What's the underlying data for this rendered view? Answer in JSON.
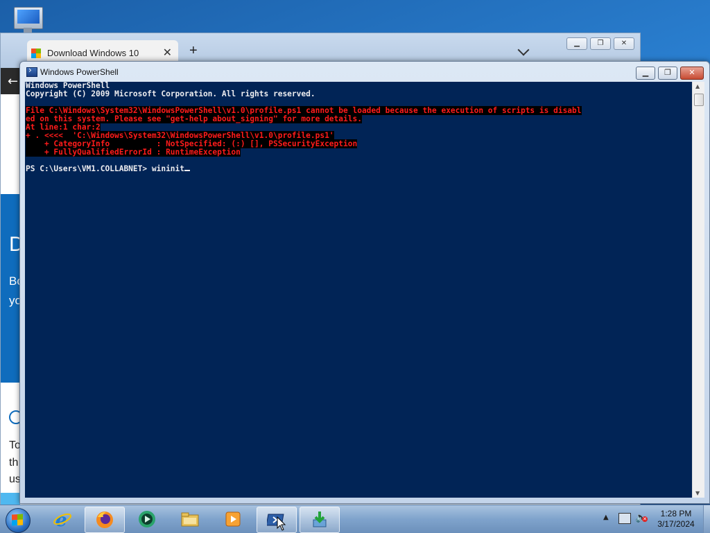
{
  "browser": {
    "tab_title": "Download Windows 10",
    "tab_close": "✕",
    "new_tab": "+",
    "back_arrow": "←",
    "hero_glyph": "D",
    "hero_lines": [
      "Bo",
      "yo"
    ],
    "body_lines": [
      "To",
      "th",
      "us"
    ]
  },
  "powershell": {
    "title": "Windows PowerShell",
    "lines": [
      {
        "text": "Windows PowerShell",
        "type": "normal"
      },
      {
        "text": "Copyright (C) 2009 Microsoft Corporation. All rights reserved.",
        "type": "normal"
      },
      {
        "text": "",
        "type": "normal"
      },
      {
        "text": "File C:\\Windows\\System32\\WindowsPowerShell\\v1.0\\profile.ps1 cannot be loaded because the execution of scripts is disabl",
        "type": "error"
      },
      {
        "text": "ed on this system. Please see \"get-help about_signing\" for more details.",
        "type": "error"
      },
      {
        "text": "At line:1 char:2",
        "type": "error"
      },
      {
        "text": "+ . <<<<  'C:\\Windows\\System32\\WindowsPowerShell\\v1.0\\profile.ps1'",
        "type": "error"
      },
      {
        "text": "    + CategoryInfo          : NotSpecified: (:) [], PSSecurityException",
        "type": "error"
      },
      {
        "text": "    + FullyQualifiedErrorId : RuntimeException",
        "type": "error"
      },
      {
        "text": "",
        "type": "normal"
      }
    ],
    "prompt": "PS C:\\Users\\VM1.COLLABNET> ",
    "command": "wininit"
  },
  "taskbar": {
    "apps": [
      "start",
      "internet-explorer",
      "firefox",
      "media-center",
      "windows-explorer",
      "media-player",
      "powershell",
      "installer"
    ],
    "active_app": "powershell",
    "clock_time": "1:28 PM",
    "clock_date": "3/17/2024",
    "tray_up_arrow": "▲"
  }
}
